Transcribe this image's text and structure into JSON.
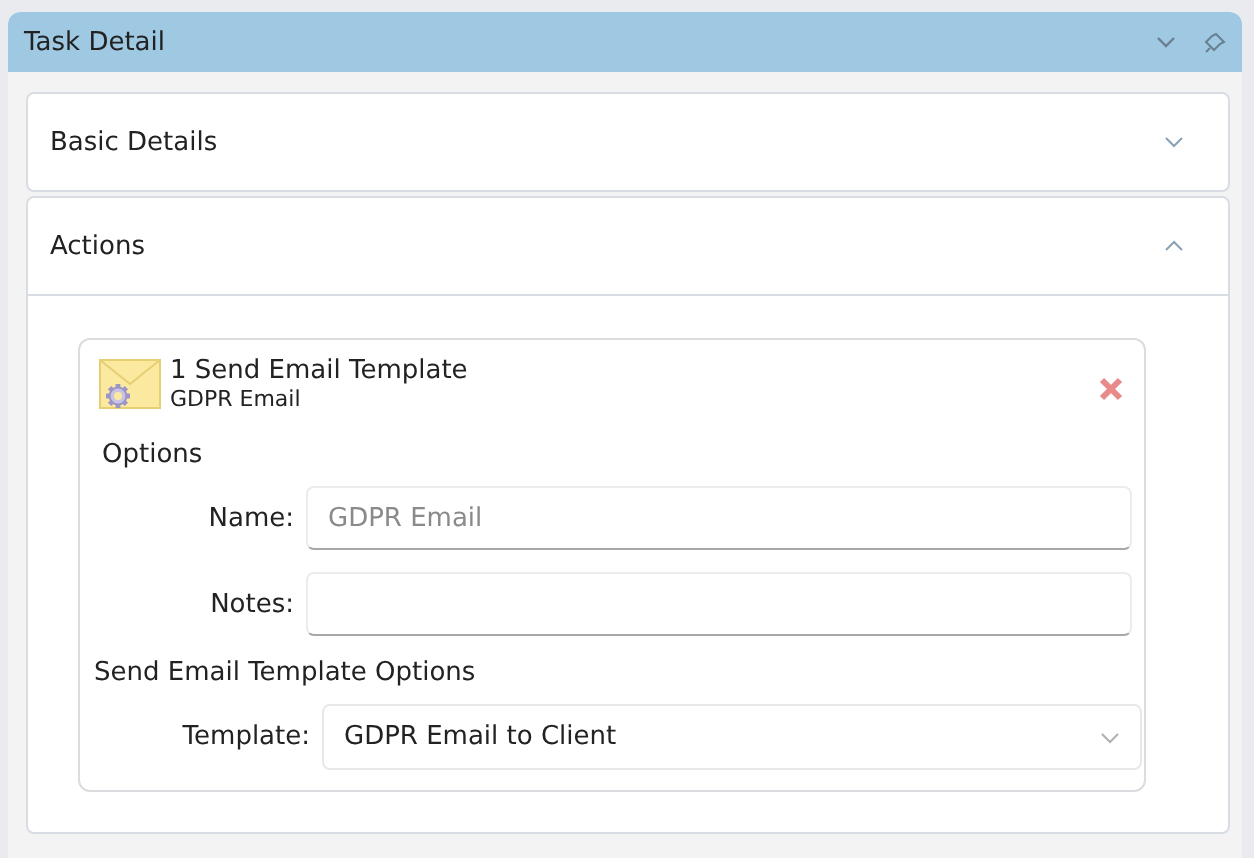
{
  "panel": {
    "title": "Task Detail"
  },
  "sections": [
    {
      "title": "Basic Details",
      "expanded": false
    },
    {
      "title": "Actions",
      "expanded": true
    }
  ],
  "action": {
    "title": "1 Send Email Template",
    "subtitle": "GDPR Email",
    "options_heading": "Options",
    "fields": [
      {
        "label": "Name:",
        "placeholder": "GDPR Email"
      },
      {
        "label": "Notes:"
      }
    ],
    "template_heading": "Send Email Template Options",
    "template": {
      "label": "Template:",
      "value": "GDPR Email to Client"
    }
  }
}
